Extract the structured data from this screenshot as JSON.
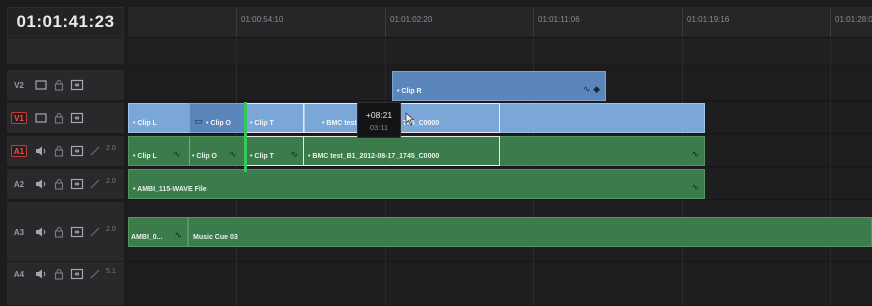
{
  "timecode": "01:01:41:23",
  "ruler": {
    "labels": [
      "01:00:54:10",
      "01:01:02:20",
      "01:01:11:06",
      "01:01:19:16",
      "01:01:28:0"
    ]
  },
  "tracks": [
    {
      "id": "V2",
      "type": "video",
      "active": false,
      "channels": ""
    },
    {
      "id": "V1",
      "type": "video",
      "active": true,
      "channels": ""
    },
    {
      "id": "A1",
      "type": "audio",
      "active": true,
      "channels": "2.0"
    },
    {
      "id": "A2",
      "type": "audio",
      "active": false,
      "channels": "2.0"
    },
    {
      "id": "A3",
      "type": "audio",
      "active": false,
      "channels": "2.0"
    },
    {
      "id": "A4",
      "type": "audio",
      "active": false,
      "channels": "5.1"
    }
  ],
  "clips": {
    "v2_clip_r": "• Clip R",
    "v1_clip_l": "• Clip L",
    "v1_clip_o": "• Clip O",
    "v1_clip_t": "• Clip T",
    "v1_bmc": "• BMC test_B",
    "v1_bmc_tail": "745_C0000",
    "a1_clip_l": "• Clip L",
    "a1_clip_o": "• Clip O",
    "a1_clip_t": "• Clip T",
    "a1_bmc": "• BMC test_B1_2012-08-17_1745_C0000",
    "a2_ambi": "• AMBI_115-WAVE File",
    "a3_ambi": "AMBI_0...",
    "a3_music": "Music Cue 03"
  },
  "tooltip": {
    "offset": "+08:21",
    "duration": "03:11"
  },
  "colors": {
    "video_clip": "#7aa7d8",
    "audio_clip": "#3b7b4c",
    "playhead": "#34c759",
    "active_track": "#c7383b"
  }
}
